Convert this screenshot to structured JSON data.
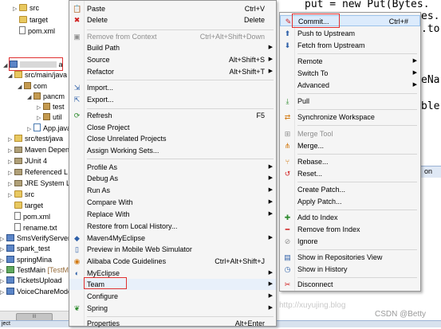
{
  "editor": {
    "line1": "put = new Put(Bytes.",
    "line2": "es.",
    "line3": ".to",
    "line4": "eNa",
    "line5": "ble",
    "console_tab": "on",
    "watermark_left": "http://xuyujing.blog",
    "watermark_right": "CSDN @Betty"
  },
  "tree": {
    "items": [
      {
        "label": "src",
        "icon": "folder"
      },
      {
        "label": "target",
        "icon": "folder"
      },
      {
        "label": "pom.xml",
        "icon": "xml-file"
      },
      {
        "label": "a",
        "icon": "project"
      },
      {
        "label": "src/main/java",
        "icon": "source-folder"
      },
      {
        "label": "com",
        "icon": "package"
      },
      {
        "label": "pancm",
        "icon": "package"
      },
      {
        "label": "test",
        "icon": "package"
      },
      {
        "label": "util",
        "icon": "package"
      },
      {
        "label": "App.java",
        "icon": "java-file"
      },
      {
        "label": "src/test/java",
        "icon": "source-folder"
      },
      {
        "label": "Maven Depen",
        "icon": "library"
      },
      {
        "label": "JUnit 4",
        "icon": "library"
      },
      {
        "label": "Referenced L",
        "icon": "library"
      },
      {
        "label": "JRE System Li",
        "icon": "library"
      },
      {
        "label": "src",
        "icon": "folder"
      },
      {
        "label": "target",
        "icon": "folder"
      },
      {
        "label": "pom.xml",
        "icon": "xml-file"
      },
      {
        "label": "rename.txt",
        "icon": "text-file"
      },
      {
        "label": "SmsVerifyServer",
        "icon": "project"
      },
      {
        "label": "spark_test",
        "icon": "project"
      },
      {
        "label": "springMina",
        "icon": "project"
      },
      {
        "label": "TestMain",
        "suffix": "[TestM",
        "icon": "project"
      },
      {
        "label": "TicketsUpload",
        "icon": "project"
      },
      {
        "label": "VoiceChareMode",
        "icon": "project"
      }
    ],
    "scroll_thumb_label": "III"
  },
  "status": {
    "text": "ject"
  },
  "menu_main": {
    "items": [
      {
        "label": "Paste",
        "shortcut": "Ctrl+V",
        "icon": "paste-icon"
      },
      {
        "label": "Delete",
        "shortcut": "Delete",
        "icon": "delete-icon"
      },
      {
        "label": "Remove from Context",
        "shortcut": "Ctrl+Alt+Shift+Down",
        "icon": "remove-context-icon"
      },
      {
        "label": "Build Path",
        "icon": ""
      },
      {
        "label": "Source",
        "shortcut": "Alt+Shift+S",
        "icon": ""
      },
      {
        "label": "Refactor",
        "shortcut": "Alt+Shift+T",
        "icon": ""
      },
      {
        "label": "Import...",
        "icon": "import-icon"
      },
      {
        "label": "Export...",
        "icon": "export-icon"
      },
      {
        "label": "Refresh",
        "shortcut": "F5",
        "icon": "refresh-icon"
      },
      {
        "label": "Close Project",
        "icon": ""
      },
      {
        "label": "Close Unrelated Projects",
        "icon": ""
      },
      {
        "label": "Assign Working Sets...",
        "icon": ""
      },
      {
        "label": "Profile As",
        "icon": ""
      },
      {
        "label": "Debug As",
        "icon": ""
      },
      {
        "label": "Run As",
        "icon": ""
      },
      {
        "label": "Compare With",
        "icon": ""
      },
      {
        "label": "Replace With",
        "icon": ""
      },
      {
        "label": "Restore from Local History...",
        "icon": ""
      },
      {
        "label": "Maven4MyEclipse",
        "icon": "maven-icon"
      },
      {
        "label": "Preview in Mobile Web Simulator",
        "icon": "mobile-icon"
      },
      {
        "label": "Alibaba Code Guidelines",
        "shortcut": "Ctrl+Alt+Shift+J",
        "icon": "alibaba-icon"
      },
      {
        "label": "MyEclipse",
        "icon": "myeclipse-icon"
      },
      {
        "label": "Team",
        "icon": ""
      },
      {
        "label": "Configure",
        "icon": ""
      },
      {
        "label": "Spring",
        "icon": "spring-icon"
      },
      {
        "label": "Properties",
        "shortcut": "Alt+Enter",
        "icon": ""
      }
    ]
  },
  "menu_team": {
    "items": [
      {
        "label": "Commit...",
        "shortcut": "Ctrl+#",
        "icon": "commit-icon"
      },
      {
        "label": "Push to Upstream",
        "icon": "push-icon"
      },
      {
        "label": "Fetch from Upstream",
        "icon": "fetch-icon"
      },
      {
        "label": "Remote",
        "icon": ""
      },
      {
        "label": "Switch To",
        "icon": ""
      },
      {
        "label": "Advanced",
        "icon": ""
      },
      {
        "label": "Pull",
        "icon": "pull-icon"
      },
      {
        "label": "Synchronize Workspace",
        "icon": "synchronize-icon"
      },
      {
        "label": "Merge Tool",
        "icon": "merge-tool-icon"
      },
      {
        "label": "Merge...",
        "icon": "merge-icon"
      },
      {
        "label": "Rebase...",
        "icon": "rebase-icon"
      },
      {
        "label": "Reset...",
        "icon": "reset-icon"
      },
      {
        "label": "Create Patch...",
        "icon": ""
      },
      {
        "label": "Apply Patch...",
        "icon": ""
      },
      {
        "label": "Add to Index",
        "icon": "add-index-icon"
      },
      {
        "label": "Remove from Index",
        "icon": "remove-index-icon"
      },
      {
        "label": "Ignore",
        "icon": "ignore-icon"
      },
      {
        "label": "Show in Repositories View",
        "icon": "repositories-icon"
      },
      {
        "label": "Show in History",
        "icon": "history-icon"
      },
      {
        "label": "Disconnect",
        "icon": "disconnect-icon"
      }
    ]
  },
  "colors": {
    "menu_bg": "#f5f5f5",
    "highlight_box": "#e03030",
    "selected_row": "#dcebfc",
    "keyword": "#7f0055"
  }
}
